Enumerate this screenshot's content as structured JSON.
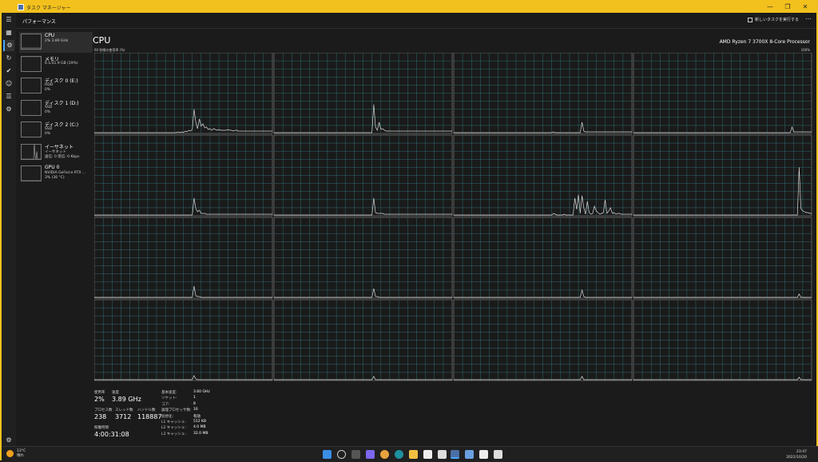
{
  "window": {
    "title": "タスク マネージャー"
  },
  "header": {
    "page_title": "パフォーマンス",
    "run_task_label": "新しいタスクを実行する"
  },
  "sidebar": {
    "items": [
      {
        "name": "CPU",
        "line2": "2%  3.89 GHz",
        "line3": "",
        "line4": ""
      },
      {
        "name": "メモリ",
        "line2": "6.1/31.9 GB (19%)",
        "line3": "",
        "line4": ""
      },
      {
        "name": "ディスク 0 (E:)",
        "line2": "HDD",
        "line3": "0%",
        "line4": ""
      },
      {
        "name": "ディスク 1 (D:)",
        "line2": "SSD",
        "line3": "0%",
        "line4": ""
      },
      {
        "name": "ディスク 2 (C:)",
        "line2": "SSD",
        "line3": "0%",
        "line4": ""
      },
      {
        "name": "イーサネット",
        "line2": "イーサネット",
        "line3": "送信: 0 受信: 0 Kbps",
        "line4": ""
      },
      {
        "name": "GPU 0",
        "line2": "NVIDIA GeForce RTX ...",
        "line3": "3% (36 °C)",
        "line4": ""
      }
    ]
  },
  "main": {
    "title": "CPU",
    "model": "AMD Ryzen 7 3700X 8-Core Processor",
    "graph_label": "60 秒間の使用率 (%)",
    "graph_max": "100%",
    "stats": {
      "usage_label": "使用率",
      "usage": "2%",
      "speed_label": "速度",
      "speed": "3.89 GHz",
      "proc_label": "プロセス数",
      "proc": "238",
      "thread_label": "スレッド数",
      "thread": "3712",
      "handle_label": "ハンドル数",
      "handle": "118887",
      "uptime_label": "稼働時間",
      "uptime": "4:00:31:08"
    },
    "details": [
      {
        "k": "基本速度:",
        "v": "3.60 GHz"
      },
      {
        "k": "ソケット:",
        "v": "1"
      },
      {
        "k": "コア:",
        "v": "8"
      },
      {
        "k": "論理プロセッサ数:",
        "v": "16"
      },
      {
        "k": "仮想化:",
        "v": "有効"
      },
      {
        "k": "L1 キャッシュ:",
        "v": "512 KB"
      },
      {
        "k": "L2 キャッシュ:",
        "v": "4.0 MB"
      },
      {
        "k": "L3 キャッシュ:",
        "v": "32.0 MB"
      }
    ]
  },
  "taskbar": {
    "temp": "13°C",
    "weather": "晴れ",
    "time": "23:47",
    "date": "2022/10/20"
  },
  "core_series": [
    [
      1,
      1,
      1,
      1,
      1,
      1,
      1,
      1,
      1,
      1,
      1,
      1,
      1,
      1,
      1,
      1,
      1,
      1,
      1,
      1,
      1,
      1,
      1,
      1,
      1,
      1,
      1,
      1,
      1,
      1,
      1,
      1,
      1,
      1,
      1,
      1,
      1,
      1,
      1,
      1,
      1,
      1,
      1,
      1,
      1,
      1,
      1,
      2,
      1,
      2,
      1,
      3,
      2,
      4,
      3,
      5,
      30,
      14,
      6,
      18,
      9,
      12,
      7,
      8,
      5,
      6,
      4,
      6,
      5,
      4,
      5,
      4,
      4,
      4,
      4,
      5,
      4,
      4,
      3,
      4,
      4,
      3,
      3,
      3,
      3,
      3,
      3,
      3,
      3,
      3,
      3,
      3,
      3,
      3,
      3,
      3,
      3,
      3,
      3,
      3,
      3
    ],
    [
      1,
      1,
      1,
      1,
      1,
      1,
      1,
      1,
      1,
      1,
      1,
      1,
      1,
      1,
      1,
      1,
      1,
      1,
      1,
      1,
      1,
      1,
      1,
      1,
      1,
      1,
      1,
      1,
      1,
      1,
      1,
      1,
      1,
      1,
      1,
      1,
      1,
      1,
      1,
      1,
      1,
      1,
      1,
      1,
      1,
      1,
      1,
      1,
      1,
      1,
      1,
      1,
      1,
      1,
      1,
      1,
      36,
      8,
      4,
      14,
      5,
      6,
      4,
      3,
      3,
      3,
      3,
      3,
      3,
      3,
      3,
      3,
      3,
      3,
      3,
      3,
      3,
      3,
      3,
      3,
      3,
      3,
      3,
      3,
      3,
      3,
      3,
      3,
      3,
      3,
      3,
      3,
      3,
      3,
      3,
      3,
      3,
      3,
      3,
      3,
      3
    ],
    [
      1,
      1,
      1,
      1,
      1,
      1,
      1,
      1,
      1,
      1,
      1,
      1,
      1,
      1,
      1,
      1,
      1,
      1,
      1,
      1,
      1,
      1,
      1,
      1,
      1,
      1,
      1,
      1,
      1,
      1,
      1,
      1,
      1,
      1,
      1,
      1,
      1,
      1,
      1,
      1,
      1,
      1,
      1,
      1,
      1,
      1,
      1,
      1,
      1,
      1,
      1,
      1,
      1,
      1,
      1,
      1,
      2,
      1,
      1,
      1,
      1,
      1,
      1,
      1,
      1,
      1,
      1,
      1,
      1,
      1,
      1,
      1,
      14,
      3,
      2,
      2,
      2,
      2,
      2,
      2,
      2,
      2,
      2,
      2,
      2,
      2,
      2,
      2,
      2,
      2,
      2,
      2,
      2,
      2,
      2,
      2,
      2,
      2,
      2,
      2,
      2
    ],
    [
      1,
      1,
      1,
      1,
      1,
      1,
      1,
      1,
      1,
      1,
      1,
      1,
      1,
      1,
      1,
      1,
      1,
      1,
      1,
      1,
      1,
      1,
      1,
      1,
      1,
      1,
      1,
      1,
      1,
      1,
      1,
      1,
      1,
      1,
      1,
      1,
      1,
      1,
      1,
      1,
      1,
      1,
      1,
      1,
      1,
      1,
      1,
      1,
      1,
      1,
      1,
      1,
      1,
      1,
      1,
      1,
      1,
      1,
      1,
      1,
      1,
      1,
      1,
      1,
      1,
      1,
      1,
      1,
      1,
      1,
      1,
      1,
      1,
      1,
      1,
      1,
      1,
      1,
      1,
      1,
      1,
      1,
      1,
      1,
      1,
      1,
      1,
      1,
      1,
      8,
      2,
      2,
      2,
      2,
      2,
      2,
      2,
      2,
      2,
      2,
      2
    ],
    [
      1,
      1,
      1,
      1,
      1,
      1,
      1,
      1,
      1,
      1,
      1,
      1,
      1,
      1,
      1,
      1,
      1,
      1,
      1,
      1,
      1,
      1,
      1,
      1,
      1,
      1,
      1,
      1,
      1,
      1,
      1,
      1,
      1,
      1,
      1,
      1,
      1,
      1,
      1,
      1,
      1,
      1,
      1,
      1,
      1,
      1,
      1,
      1,
      1,
      1,
      1,
      1,
      1,
      1,
      1,
      1,
      22,
      9,
      5,
      7,
      3,
      3,
      3,
      2,
      2,
      2,
      2,
      2,
      2,
      2,
      2,
      2,
      2,
      2,
      2,
      2,
      2,
      2,
      2,
      2,
      2,
      2,
      2,
      2,
      2,
      2,
      2,
      2,
      2,
      2,
      2,
      2,
      2,
      2,
      2,
      2,
      2,
      2,
      2,
      2,
      2
    ],
    [
      1,
      1,
      1,
      1,
      1,
      1,
      1,
      1,
      1,
      1,
      1,
      1,
      1,
      1,
      1,
      1,
      1,
      1,
      1,
      1,
      1,
      1,
      1,
      1,
      1,
      1,
      1,
      1,
      1,
      1,
      1,
      1,
      1,
      1,
      1,
      1,
      1,
      1,
      1,
      1,
      1,
      1,
      1,
      1,
      1,
      1,
      1,
      1,
      1,
      1,
      1,
      1,
      1,
      1,
      1,
      1,
      22,
      4,
      3,
      3,
      3,
      3,
      2,
      2,
      2,
      2,
      2,
      2,
      2,
      2,
      2,
      2,
      2,
      2,
      2,
      2,
      2,
      2,
      2,
      2,
      2,
      2,
      2,
      2,
      2,
      2,
      2,
      2,
      2,
      2,
      2,
      2,
      2,
      2,
      2,
      2,
      2,
      2,
      2,
      2,
      2
    ],
    [
      1,
      1,
      1,
      1,
      1,
      1,
      1,
      1,
      1,
      1,
      1,
      1,
      1,
      1,
      1,
      1,
      1,
      1,
      1,
      1,
      1,
      1,
      1,
      1,
      1,
      1,
      1,
      1,
      1,
      1,
      1,
      1,
      1,
      1,
      1,
      1,
      1,
      1,
      1,
      1,
      1,
      1,
      1,
      1,
      1,
      1,
      1,
      1,
      1,
      1,
      1,
      1,
      1,
      1,
      1,
      1,
      3,
      2,
      1,
      1,
      1,
      1,
      2,
      1,
      1,
      1,
      1,
      1,
      22,
      8,
      26,
      3,
      25,
      10,
      2,
      18,
      4,
      2,
      3,
      12,
      6,
      4,
      2,
      3,
      4,
      20,
      3,
      6,
      10,
      3,
      4,
      2,
      3,
      3,
      2,
      2,
      2,
      2,
      2,
      2,
      2
    ],
    [
      1,
      1,
      1,
      1,
      1,
      1,
      1,
      1,
      1,
      1,
      1,
      1,
      1,
      1,
      1,
      1,
      1,
      1,
      1,
      1,
      1,
      1,
      1,
      1,
      1,
      1,
      1,
      1,
      1,
      1,
      1,
      1,
      1,
      1,
      1,
      1,
      1,
      1,
      1,
      1,
      1,
      1,
      1,
      1,
      1,
      1,
      1,
      1,
      1,
      1,
      1,
      1,
      1,
      1,
      1,
      1,
      1,
      1,
      1,
      1,
      1,
      1,
      1,
      1,
      1,
      1,
      1,
      1,
      1,
      1,
      1,
      1,
      1,
      1,
      1,
      1,
      1,
      1,
      1,
      1,
      1,
      1,
      1,
      1,
      1,
      1,
      1,
      1,
      1,
      1,
      1,
      1,
      1,
      60,
      9,
      6,
      5,
      4,
      4,
      3,
      3
    ],
    [
      1,
      1,
      1,
      1,
      1,
      1,
      1,
      1,
      1,
      1,
      1,
      1,
      1,
      1,
      1,
      1,
      1,
      1,
      1,
      1,
      1,
      1,
      1,
      1,
      1,
      1,
      1,
      1,
      1,
      1,
      1,
      1,
      1,
      1,
      1,
      1,
      1,
      1,
      1,
      1,
      1,
      1,
      1,
      1,
      1,
      1,
      1,
      1,
      1,
      1,
      1,
      1,
      1,
      1,
      1,
      1,
      15,
      3,
      2,
      2,
      1,
      1,
      1,
      1,
      1,
      1,
      1,
      1,
      1,
      1,
      1,
      1,
      1,
      1,
      1,
      1,
      1,
      1,
      1,
      1,
      1,
      1,
      1,
      1,
      1,
      1,
      1,
      1,
      1,
      1,
      1,
      1,
      1,
      1,
      1,
      1,
      1,
      1,
      1,
      1,
      1
    ],
    [
      1,
      1,
      1,
      1,
      1,
      1,
      1,
      1,
      1,
      1,
      1,
      1,
      1,
      1,
      1,
      1,
      1,
      1,
      1,
      1,
      1,
      1,
      1,
      1,
      1,
      1,
      1,
      1,
      1,
      1,
      1,
      1,
      1,
      1,
      1,
      1,
      1,
      1,
      1,
      1,
      1,
      1,
      1,
      1,
      1,
      1,
      1,
      1,
      1,
      1,
      1,
      1,
      1,
      1,
      1,
      1,
      12,
      2,
      2,
      1,
      1,
      1,
      1,
      1,
      1,
      1,
      1,
      1,
      1,
      1,
      1,
      1,
      1,
      1,
      1,
      1,
      1,
      1,
      1,
      1,
      1,
      1,
      1,
      1,
      1,
      1,
      1,
      1,
      1,
      1,
      1,
      1,
      1,
      1,
      1,
      1,
      1,
      1,
      1,
      1,
      1
    ],
    [
      1,
      1,
      1,
      1,
      1,
      1,
      1,
      1,
      1,
      1,
      1,
      1,
      1,
      1,
      1,
      1,
      1,
      1,
      1,
      1,
      1,
      1,
      1,
      1,
      1,
      1,
      1,
      1,
      1,
      1,
      1,
      1,
      1,
      1,
      1,
      1,
      1,
      1,
      1,
      1,
      1,
      1,
      1,
      1,
      1,
      1,
      1,
      1,
      1,
      1,
      1,
      1,
      1,
      1,
      1,
      1,
      1,
      1,
      1,
      1,
      1,
      1,
      1,
      1,
      1,
      1,
      1,
      1,
      1,
      1,
      1,
      1,
      10,
      2,
      1,
      1,
      1,
      1,
      1,
      1,
      1,
      1,
      1,
      1,
      1,
      1,
      1,
      1,
      1,
      1,
      1,
      1,
      1,
      1,
      1,
      1,
      1,
      1,
      1,
      1,
      1
    ],
    [
      1,
      1,
      1,
      1,
      1,
      1,
      1,
      1,
      1,
      1,
      1,
      1,
      1,
      1,
      1,
      1,
      1,
      1,
      1,
      1,
      1,
      1,
      1,
      1,
      1,
      1,
      1,
      1,
      1,
      1,
      1,
      1,
      1,
      1,
      1,
      1,
      1,
      1,
      1,
      1,
      1,
      1,
      1,
      1,
      1,
      1,
      1,
      1,
      1,
      1,
      1,
      1,
      1,
      1,
      1,
      1,
      1,
      1,
      1,
      1,
      1,
      1,
      1,
      1,
      1,
      1,
      1,
      1,
      1,
      1,
      1,
      1,
      1,
      1,
      1,
      1,
      1,
      1,
      1,
      1,
      1,
      1,
      1,
      1,
      1,
      1,
      1,
      1,
      1,
      1,
      1,
      1,
      1,
      5,
      1,
      1,
      1,
      1,
      1,
      1,
      1
    ],
    [
      1,
      1,
      1,
      1,
      1,
      1,
      1,
      1,
      1,
      1,
      1,
      1,
      1,
      1,
      1,
      1,
      1,
      1,
      1,
      1,
      1,
      1,
      1,
      1,
      1,
      1,
      1,
      1,
      1,
      1,
      1,
      1,
      1,
      1,
      1,
      1,
      1,
      1,
      1,
      1,
      1,
      1,
      1,
      1,
      1,
      1,
      1,
      1,
      1,
      1,
      1,
      1,
      1,
      1,
      1,
      1,
      6,
      2,
      1,
      1,
      1,
      1,
      1,
      1,
      1,
      1,
      1,
      1,
      1,
      1,
      1,
      1,
      1,
      1,
      1,
      1,
      1,
      1,
      1,
      1,
      1,
      1,
      1,
      1,
      1,
      1,
      1,
      1,
      1,
      1,
      1,
      1,
      1,
      1,
      1,
      1,
      1,
      1,
      1,
      1,
      1
    ],
    [
      1,
      1,
      1,
      1,
      1,
      1,
      1,
      1,
      1,
      1,
      1,
      1,
      1,
      1,
      1,
      1,
      1,
      1,
      1,
      1,
      1,
      1,
      1,
      1,
      1,
      1,
      1,
      1,
      1,
      1,
      1,
      1,
      1,
      1,
      1,
      1,
      1,
      1,
      1,
      1,
      1,
      1,
      1,
      1,
      1,
      1,
      1,
      1,
      1,
      1,
      1,
      1,
      1,
      1,
      1,
      1,
      5,
      1,
      1,
      1,
      1,
      1,
      1,
      1,
      1,
      1,
      1,
      1,
      1,
      1,
      1,
      1,
      1,
      1,
      1,
      1,
      1,
      1,
      1,
      1,
      1,
      1,
      1,
      1,
      1,
      1,
      1,
      1,
      1,
      1,
      1,
      1,
      1,
      1,
      1,
      1,
      1,
      1,
      1,
      1,
      1
    ],
    [
      1,
      1,
      1,
      1,
      1,
      1,
      1,
      1,
      1,
      1,
      1,
      1,
      1,
      1,
      1,
      1,
      1,
      1,
      1,
      1,
      1,
      1,
      1,
      1,
      1,
      1,
      1,
      1,
      1,
      1,
      1,
      1,
      1,
      1,
      1,
      1,
      1,
      1,
      1,
      1,
      1,
      1,
      1,
      1,
      1,
      1,
      1,
      1,
      1,
      1,
      1,
      1,
      1,
      1,
      1,
      1,
      1,
      1,
      1,
      1,
      1,
      1,
      1,
      1,
      1,
      1,
      1,
      1,
      1,
      1,
      1,
      1,
      5,
      1,
      1,
      1,
      1,
      1,
      1,
      1,
      1,
      1,
      1,
      1,
      1,
      1,
      1,
      1,
      1,
      1,
      1,
      1,
      1,
      1,
      1,
      1,
      1,
      1,
      1,
      1,
      1
    ],
    [
      1,
      1,
      1,
      1,
      1,
      1,
      1,
      1,
      1,
      1,
      1,
      1,
      1,
      1,
      1,
      1,
      1,
      1,
      1,
      1,
      1,
      1,
      1,
      1,
      1,
      1,
      1,
      1,
      1,
      1,
      1,
      1,
      1,
      1,
      1,
      1,
      1,
      1,
      1,
      1,
      1,
      1,
      1,
      1,
      1,
      1,
      1,
      1,
      1,
      1,
      1,
      1,
      1,
      1,
      1,
      1,
      1,
      1,
      1,
      1,
      1,
      1,
      1,
      1,
      1,
      1,
      1,
      1,
      1,
      1,
      1,
      1,
      1,
      1,
      1,
      1,
      1,
      1,
      1,
      1,
      1,
      1,
      1,
      1,
      1,
      1,
      1,
      1,
      1,
      1,
      1,
      1,
      1,
      4,
      1,
      1,
      1,
      1,
      1,
      1,
      1
    ]
  ]
}
